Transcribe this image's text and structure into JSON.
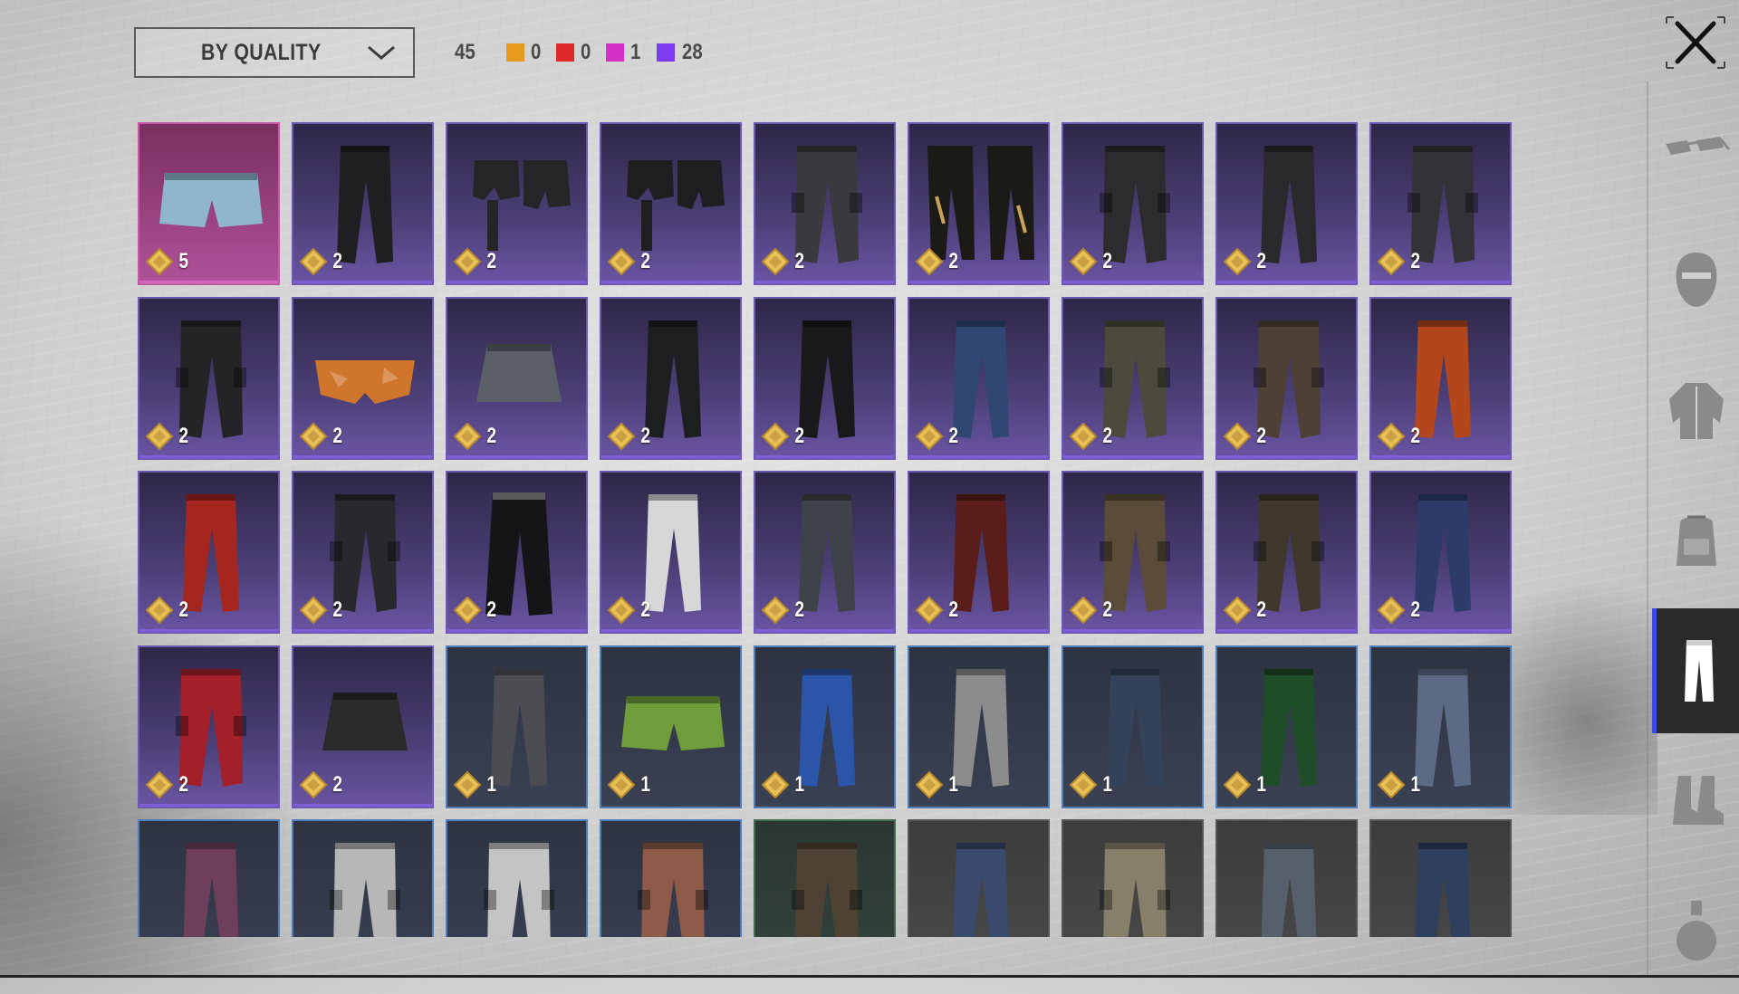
{
  "header": {
    "sort_label": "BY QUALITY",
    "total_count": "45",
    "quality_counts": [
      {
        "color": "#e69a1f",
        "value": "0"
      },
      {
        "color": "#e02a2a",
        "value": "0"
      },
      {
        "color": "#d42ec4",
        "value": "1"
      },
      {
        "color": "#7b3cf0",
        "value": "28"
      }
    ]
  },
  "items": [
    {
      "q": "pink",
      "color": "#8fb6cc",
      "shape": "shorts",
      "qty": "5"
    },
    {
      "q": "purple",
      "color": "#1f1f22",
      "shape": "slim",
      "qty": "2"
    },
    {
      "q": "purple",
      "color": "#252527",
      "shape": "shorts2",
      "qty": "2"
    },
    {
      "q": "purple",
      "color": "#1e1e20",
      "shape": "shorts2",
      "qty": "2"
    },
    {
      "q": "purple",
      "color": "#3a3a3e",
      "shape": "cargo",
      "qty": "2"
    },
    {
      "q": "purple",
      "color": "#1c1a17",
      "shape": "pair",
      "qty": "2"
    },
    {
      "q": "purple",
      "color": "#2c2c2f",
      "shape": "cargo",
      "qty": "2"
    },
    {
      "q": "purple",
      "color": "#2a2a2d",
      "shape": "slim",
      "qty": "2"
    },
    {
      "q": "purple",
      "color": "#333236",
      "shape": "cargo",
      "qty": "2"
    },
    {
      "q": "purple",
      "color": "#242427",
      "shape": "cargo",
      "qty": "2"
    },
    {
      "q": "purple",
      "color": "#d0752c",
      "shape": "brief",
      "qty": "2"
    },
    {
      "q": "purple",
      "color": "#5b6068",
      "shape": "skirt",
      "qty": "2"
    },
    {
      "q": "purple",
      "color": "#1d1e20",
      "shape": "slim",
      "qty": "2"
    },
    {
      "q": "purple",
      "color": "#19191b",
      "shape": "slim",
      "qty": "2"
    },
    {
      "q": "purple",
      "color": "#2f4772",
      "shape": "slim",
      "qty": "2"
    },
    {
      "q": "purple",
      "color": "#4b4a3c",
      "shape": "cargo",
      "qty": "2"
    },
    {
      "q": "purple",
      "color": "#4d4136",
      "shape": "cargo",
      "qty": "2"
    },
    {
      "q": "purple",
      "color": "#b4461c",
      "shape": "slim",
      "qty": "2"
    },
    {
      "q": "purple",
      "color": "#a5261f",
      "shape": "slim",
      "qty": "2"
    },
    {
      "q": "purple",
      "color": "#29292d",
      "shape": "cargo",
      "qty": "2"
    },
    {
      "q": "purple",
      "color": "#151517",
      "shape": "flare",
      "qty": "2"
    },
    {
      "q": "purple",
      "color": "#d7d7d7",
      "shape": "slim",
      "qty": "2"
    },
    {
      "q": "purple",
      "color": "#3f4249",
      "shape": "slim",
      "qty": "2"
    },
    {
      "q": "purple",
      "color": "#5a1d19",
      "shape": "slim",
      "qty": "2"
    },
    {
      "q": "purple",
      "color": "#5a4c39",
      "shape": "cargo",
      "qty": "2"
    },
    {
      "q": "purple",
      "color": "#40382c",
      "shape": "cargo",
      "qty": "2"
    },
    {
      "q": "purple",
      "color": "#2d3b6b",
      "shape": "slim",
      "qty": "2"
    },
    {
      "q": "purple",
      "color": "#a3202a",
      "shape": "cargo",
      "qty": "2"
    },
    {
      "q": "purple",
      "color": "#2a2a2a",
      "shape": "skirt",
      "qty": "2"
    },
    {
      "q": "blue",
      "color": "#4b4d52",
      "shape": "slim",
      "qty": "1"
    },
    {
      "q": "blue",
      "color": "#6f9d3b",
      "shape": "shorts",
      "qty": "1"
    },
    {
      "q": "blue",
      "color": "#2a55a8",
      "shape": "slim",
      "qty": "1"
    },
    {
      "q": "blue",
      "color": "#8c8c8c",
      "shape": "slim",
      "qty": "1"
    },
    {
      "q": "blue",
      "color": "#34425a",
      "shape": "slim",
      "qty": "1"
    },
    {
      "q": "blue",
      "color": "#1f4d27",
      "shape": "slim",
      "qty": "1"
    },
    {
      "q": "blue",
      "color": "#5c6a86",
      "shape": "slim",
      "qty": "1"
    },
    {
      "q": "blue",
      "color": "#6e3f5a",
      "shape": "slim",
      "qty": ""
    },
    {
      "q": "blue",
      "color": "#b7b7b7",
      "shape": "cargo",
      "qty": ""
    },
    {
      "q": "blue",
      "color": "#c4c4c4",
      "shape": "cargo",
      "qty": ""
    },
    {
      "q": "blue",
      "color": "#8d5b47",
      "shape": "cargo",
      "qty": ""
    },
    {
      "q": "green",
      "color": "#4e4234",
      "shape": "cargo",
      "qty": ""
    },
    {
      "q": "gray",
      "color": "#3a4a6c",
      "shape": "slim",
      "qty": ""
    },
    {
      "q": "gray",
      "color": "#86806a",
      "shape": "cargo",
      "qty": ""
    },
    {
      "q": "gray",
      "color": "#56606a",
      "shape": "slim",
      "qty": ""
    },
    {
      "q": "gray",
      "color": "#2f405e",
      "shape": "slim",
      "qty": ""
    }
  ],
  "rail": [
    {
      "name": "glasses-icon",
      "active": false
    },
    {
      "name": "mask-icon",
      "active": false
    },
    {
      "name": "jacket-icon",
      "active": false
    },
    {
      "name": "backpack-icon",
      "active": false
    },
    {
      "name": "pants-icon",
      "active": true
    },
    {
      "name": "boots-icon",
      "active": false
    },
    {
      "name": "grenade-icon",
      "active": false
    }
  ]
}
